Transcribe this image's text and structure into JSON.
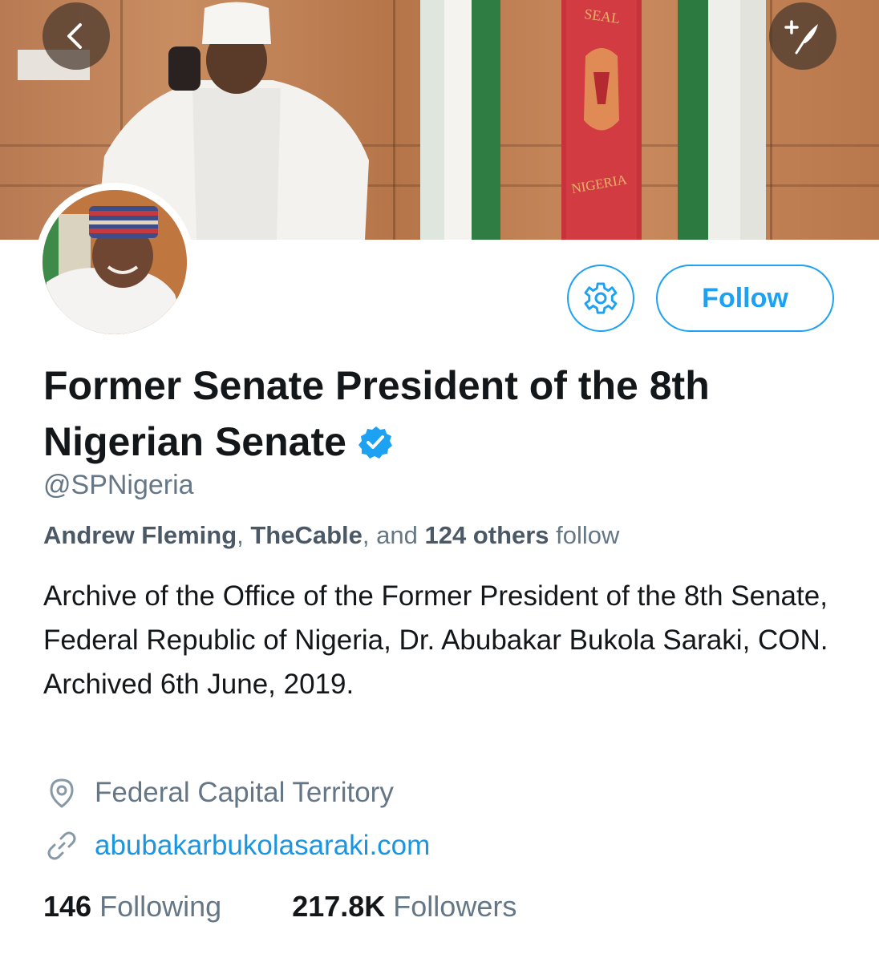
{
  "profile": {
    "display_name": "Former Senate President of the 8th Nigerian Senate",
    "handle": "@SPNigeria",
    "verified_icon": "verified-badge-icon",
    "followed_by": {
      "name1": "Andrew Fleming",
      "sep1": ", ",
      "name2": "TheCable",
      "sep2": ", and ",
      "others": "124 others",
      "suffix": " follow"
    },
    "bio": "Archive of the Office of the Former President of the 8th Senate, Federal Republic of Nigeria, Dr. Abubakar Bukola Saraki, CON. Archived 6th June, 2019.",
    "location": "Federal Capital Territory",
    "website": "abubakarbukolasaraki.com",
    "following_count": "146",
    "following_label": "Following",
    "followers_count": "217.8K",
    "followers_label": "Followers"
  },
  "banner": {
    "seal_text_top": "SEAL",
    "seal_text_bottom": "NIGERIA"
  },
  "buttons": {
    "follow_label": "Follow",
    "back_icon": "chevron-left-icon",
    "compose_icon": "compose-feather-icon",
    "settings_icon": "gear-icon"
  },
  "colors": {
    "accent": "#1da1f2",
    "link": "#1b95e0",
    "secondary_text": "#657786",
    "primary_text": "#14171a"
  }
}
